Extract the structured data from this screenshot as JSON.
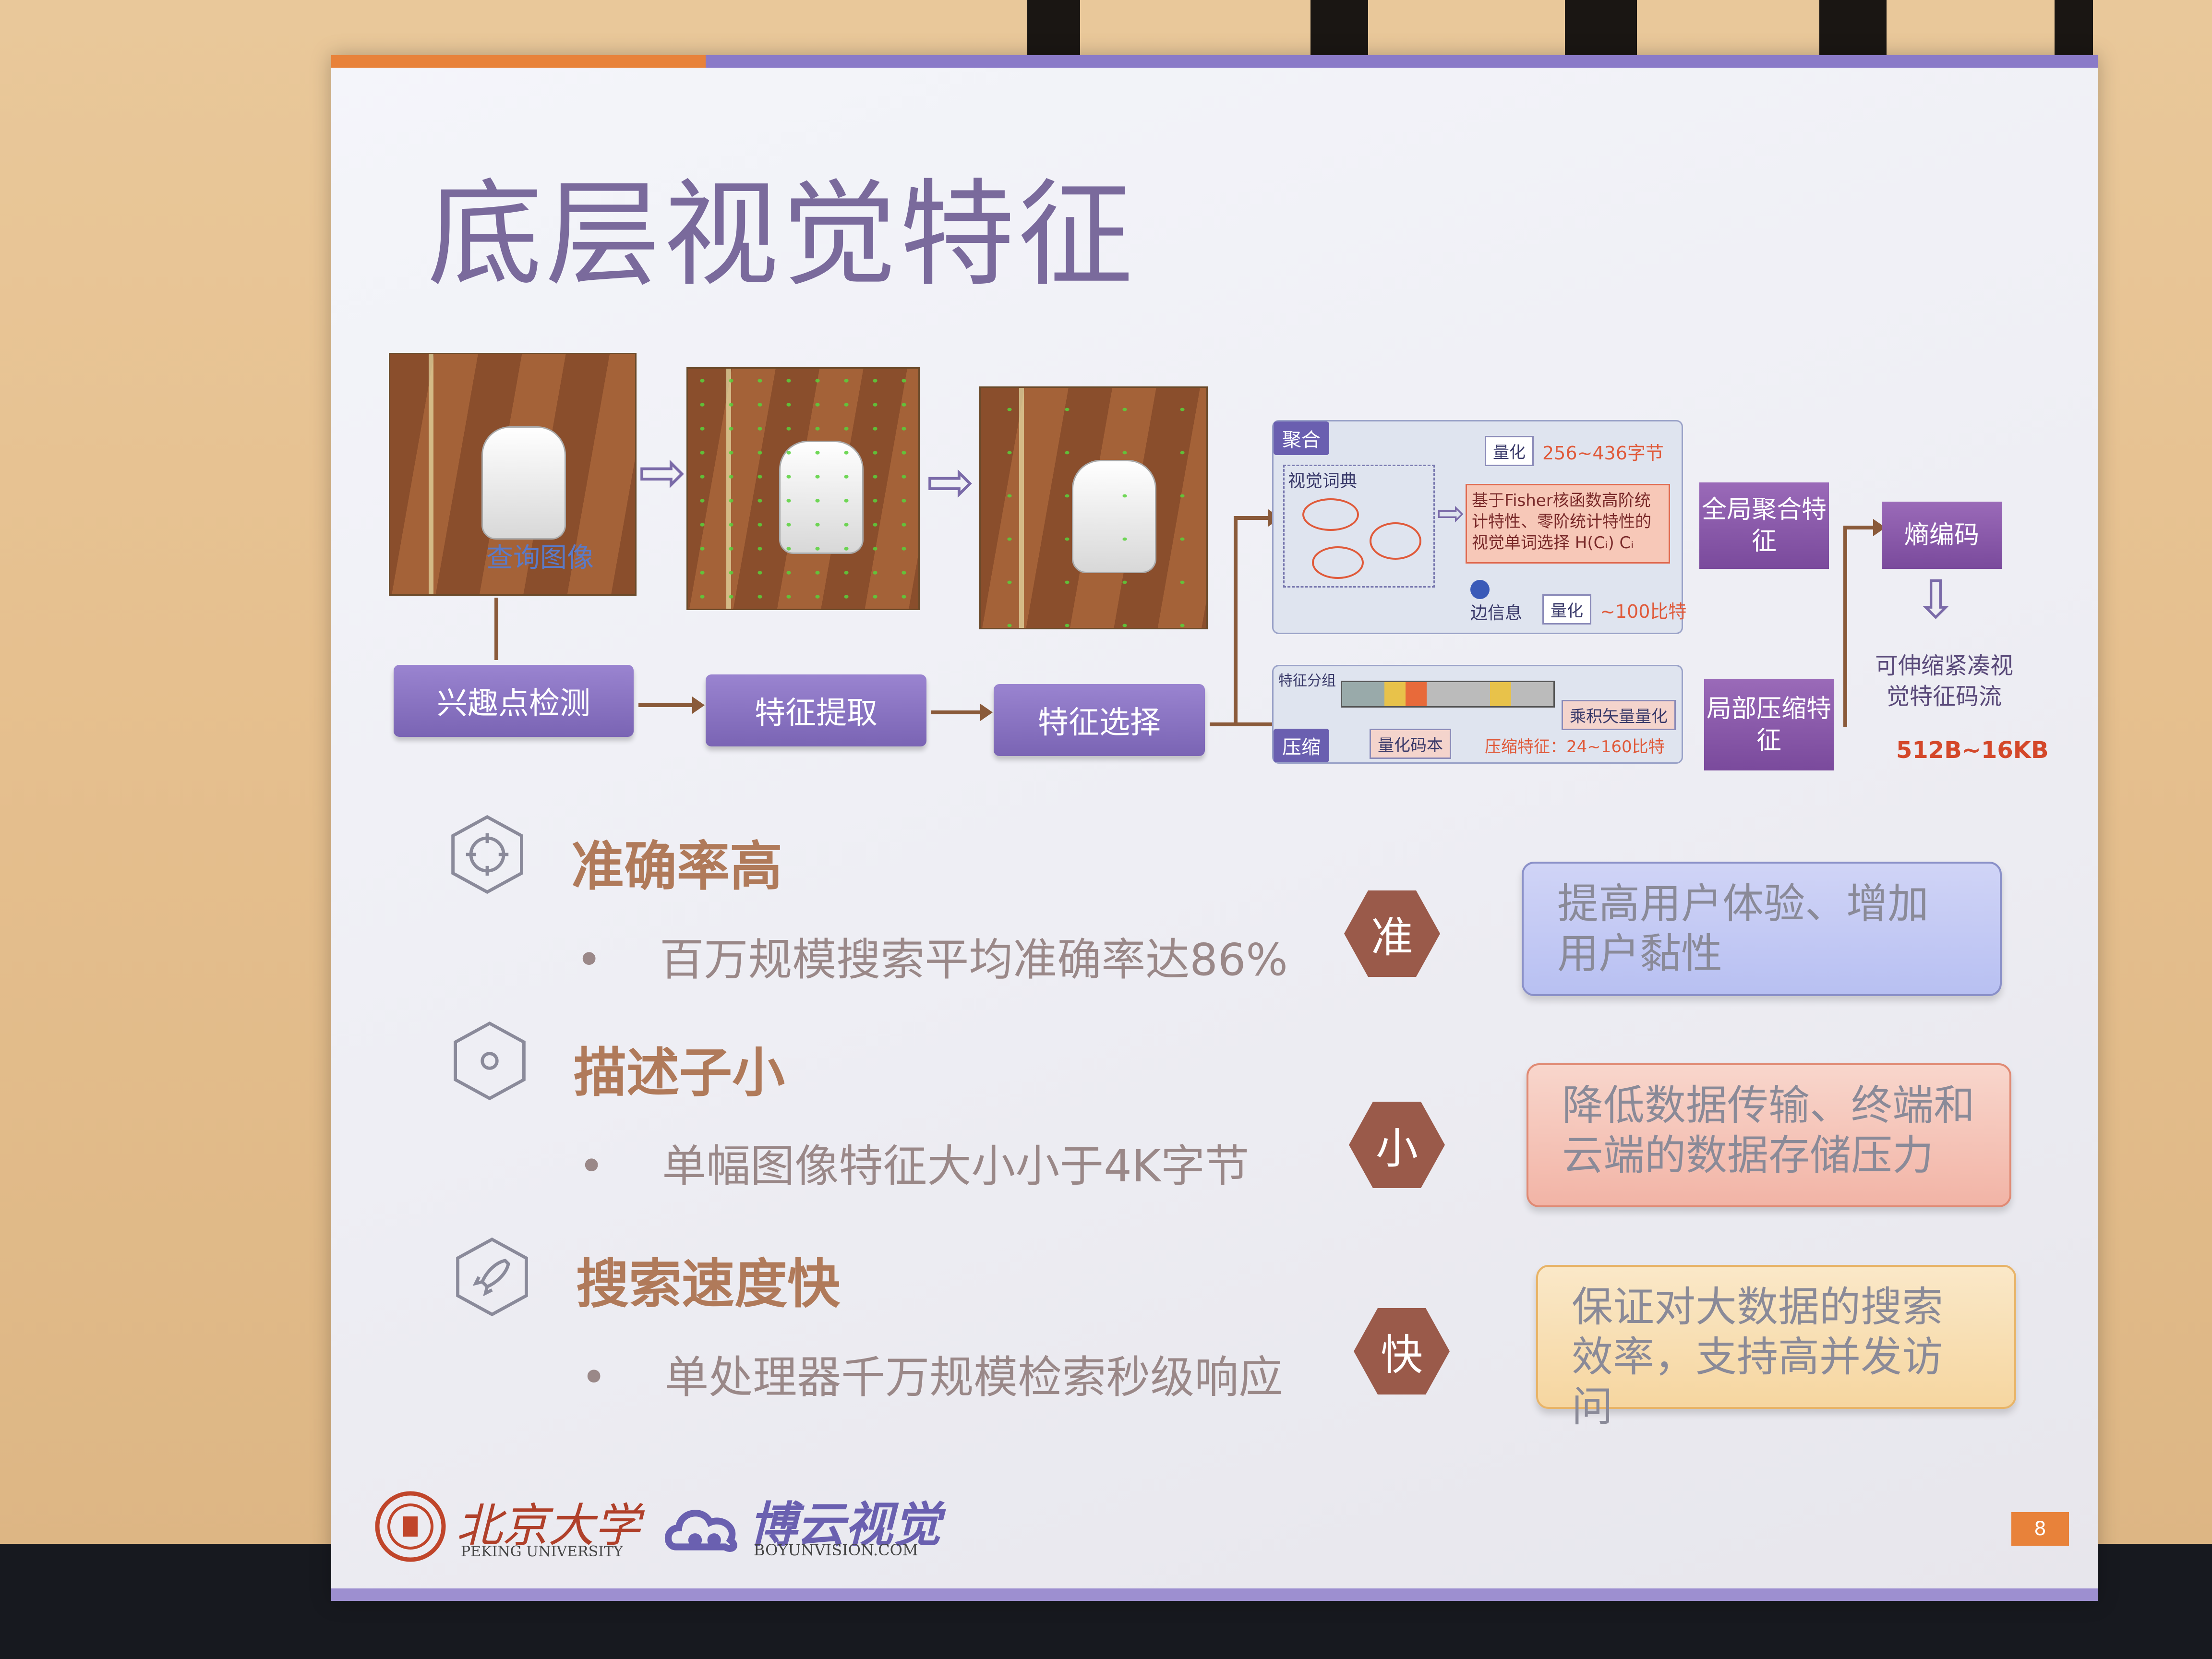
{
  "slide": {
    "title": "底层视觉特征",
    "page_number": "8"
  },
  "pipeline": {
    "photo_caption": "查询图像",
    "steps": [
      "兴趣点检测",
      "特征提取",
      "特征选择"
    ],
    "aggregation": {
      "tag": "聚合",
      "sub_label": "视觉词典",
      "quant_top": "量化",
      "quant_top_range": "256~436字节",
      "fisher_text": "基于Fisher核函数高阶统计特性、零阶统计特性的视觉单词选择 H(Cᵢ) Cᵢ",
      "edge_info": "边信息",
      "quant_bottom": "量化",
      "quant_bottom_range": "~100比特"
    },
    "compression": {
      "tag": "压缩",
      "sub_label": "特征分组",
      "vector_quant": "乘积矢量量化",
      "codebook": "量化码本",
      "compressed_range": "压缩特征：24~160比特"
    },
    "global_feature": "全局聚合特征",
    "local_feature": "局部压缩特征",
    "entropy_code": "熵编码",
    "stream_label": "可伸缩紧凑视觉特征码流",
    "stream_size": "512B~16KB"
  },
  "features": [
    {
      "icon": "target-icon",
      "title": "准确率高",
      "bullet": "百万规模搜索平均准确率达86%",
      "badge": "准",
      "benefit": "提高用户体验、增加用户黏性",
      "color": "#b8c0f2"
    },
    {
      "icon": "circle-icon",
      "title": "描述子小",
      "bullet": "单幅图像特征大小小于4K字节",
      "badge": "小",
      "benefit": "降低数据传输、终端和云端的数据存储压力",
      "color": "#f2b4a6"
    },
    {
      "icon": "rocket-icon",
      "title": "搜索速度快",
      "bullet": "单处理器千万规模检索秒级响应",
      "badge": "快",
      "benefit": "保证对大数据的搜索效率，支持高并发访问",
      "color": "#f6d6a0"
    }
  ],
  "logos": {
    "pku_cn": "北京大学",
    "pku_en": "PEKING UNIVERSITY",
    "boyun_cn": "博云视觉",
    "boyun_en": "BOYUNVISION.COM"
  }
}
